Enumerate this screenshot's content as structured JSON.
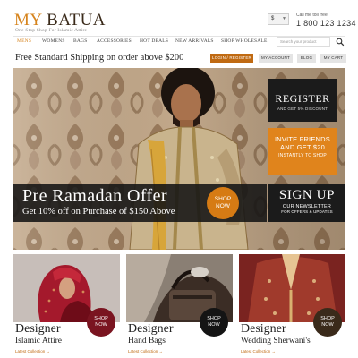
{
  "brand": {
    "my": "MY",
    "batua": "BATUA",
    "tagline": "One Stop Shop For Islamic Attire"
  },
  "header": {
    "currency": "$",
    "call_label": "Call me toll free",
    "call_number": "1 800 123 1234"
  },
  "nav": {
    "items": [
      "MENS",
      "WOMENS",
      "BAGS",
      "ACCESSORIES",
      "HOT DEALS",
      "NEW ARRIVALS",
      "SHOP WHOLESALE"
    ],
    "active": "MENS",
    "search_placeholder": "Search your product"
  },
  "topbar": {
    "shipping": "Free Standard Shipping on order above $200",
    "buttons": [
      "LOGIN / REGISTER",
      "MY ACCOUNT",
      "BLOG",
      "MY CART"
    ]
  },
  "hero": {
    "register_title": "REGISTER",
    "register_sub": "AND GET 5% DISCOUNT",
    "invite_lines": [
      "INVITE FRIENDS",
      "AND GET $20"
    ],
    "invite_sub": "INSTANTLY TO SHOP",
    "offer_title": "Pre Ramadan Offer",
    "offer_sub": "Get 10% off on Purchase of $150 Above",
    "shop_now_lines": [
      "SHOP",
      "NOW"
    ],
    "signup_title": "SIGN UP",
    "signup_sub": "OUR NEWSLETTER",
    "signup_sub2": "FOR OFFERS & UPDATES"
  },
  "tiles": [
    {
      "title": "Designer",
      "subtitle": "Islamic Attire",
      "link": "Latest Collection",
      "shop_lines": [
        "SHOP",
        "NOW"
      ],
      "badge_color": "#7a1420"
    },
    {
      "title": "Designer",
      "subtitle": "Hand Bags",
      "link": "Latest Collection",
      "shop_lines": [
        "SHOP",
        "NOW"
      ],
      "badge_color": "#141414"
    },
    {
      "title": "Designer",
      "subtitle": "Wedding Sherwani's",
      "link": "Latest Collection",
      "shop_lines": [
        "SHOP",
        "NOW"
      ],
      "badge_color": "#3a2a1a"
    }
  ],
  "colors": {
    "accent": "#d6841e",
    "accent_dark": "#c06a12",
    "dark": "#1b1b1b"
  },
  "icons": {
    "search": "search-icon",
    "dropdown": "chevron-down-icon",
    "link_arrow": "arrow-right-icon"
  }
}
